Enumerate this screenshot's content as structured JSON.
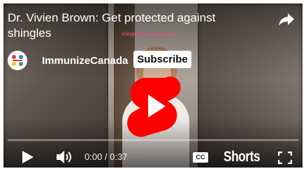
{
  "video": {
    "title": "Dr. Vivien Brown: Get protected against shingles",
    "caption": "shingles is immunization",
    "progress": 0
  },
  "channel": {
    "name": "ImmunizeCanada",
    "subscribe_label": "Subscribe",
    "avatar_icon": "immunize-canada-logo"
  },
  "controls": {
    "time": "0:00 / 0:37",
    "cc_label": "CC",
    "shorts_label": "Shorts",
    "icons": [
      "play-icon",
      "volume-icon",
      "cc-icon",
      "fullscreen-icon",
      "share-icon"
    ]
  },
  "colors": {
    "accent": "#ff0000",
    "shorts_logo": "#ff0000",
    "caption_text": "#ff4a7a"
  }
}
